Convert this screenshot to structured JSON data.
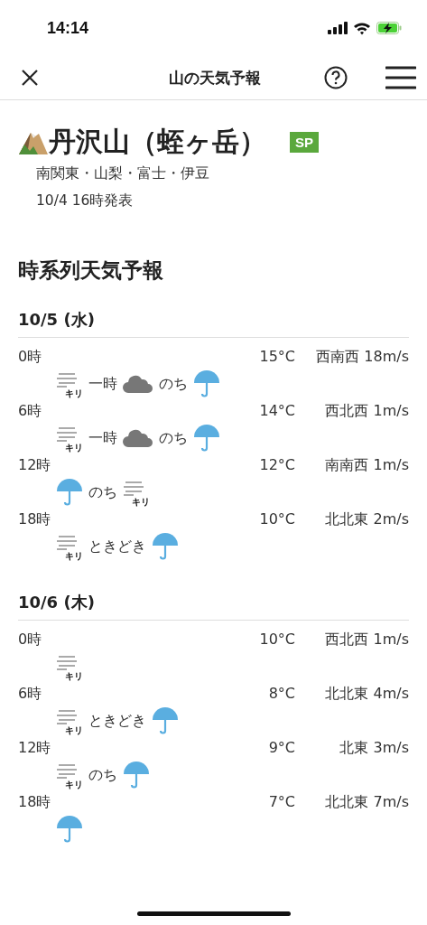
{
  "status_bar": {
    "time": "14:14"
  },
  "header": {
    "title": "山の天気予報"
  },
  "mountain": {
    "name": "丹沢山（蛭ヶ岳）",
    "badge": "SP",
    "region": "南関東・山梨・富士・伊豆",
    "issued": "10/4 16時発表"
  },
  "section_title": "時系列天気予報",
  "days": [
    {
      "date": "10/5 (水)",
      "rows": [
        {
          "hour": "0時",
          "temp": "15°C",
          "wind": "西南西 18m/s",
          "weather": [
            {
              "kind": "fog",
              "label": "キリ"
            },
            {
              "kind": "word",
              "text": "一時"
            },
            {
              "kind": "cloud"
            },
            {
              "kind": "word",
              "text": "のち"
            },
            {
              "kind": "rain"
            }
          ]
        },
        {
          "hour": "6時",
          "temp": "14°C",
          "wind": "西北西 1m/s",
          "weather": [
            {
              "kind": "fog",
              "label": "キリ"
            },
            {
              "kind": "word",
              "text": "一時"
            },
            {
              "kind": "cloud"
            },
            {
              "kind": "word",
              "text": "のち"
            },
            {
              "kind": "rain"
            }
          ]
        },
        {
          "hour": "12時",
          "temp": "12°C",
          "wind": "南南西 1m/s",
          "weather": [
            {
              "kind": "rain"
            },
            {
              "kind": "word",
              "text": "のち"
            },
            {
              "kind": "fog",
              "label": "キリ"
            }
          ]
        },
        {
          "hour": "18時",
          "temp": "10°C",
          "wind": "北北東 2m/s",
          "weather": [
            {
              "kind": "fog",
              "label": "キリ"
            },
            {
              "kind": "word",
              "text": "ときどき"
            },
            {
              "kind": "rain"
            }
          ]
        }
      ]
    },
    {
      "date": "10/6 (木)",
      "rows": [
        {
          "hour": "0時",
          "temp": "10°C",
          "wind": "西北西 1m/s",
          "weather": [
            {
              "kind": "fog",
              "label": "キリ"
            }
          ]
        },
        {
          "hour": "6時",
          "temp": "8°C",
          "wind": "北北東 4m/s",
          "weather": [
            {
              "kind": "fog",
              "label": "キリ"
            },
            {
              "kind": "word",
              "text": "ときどき"
            },
            {
              "kind": "rain"
            }
          ]
        },
        {
          "hour": "12時",
          "temp": "9°C",
          "wind": "北東 3m/s",
          "weather": [
            {
              "kind": "fog",
              "label": "キリ"
            },
            {
              "kind": "word",
              "text": "のち"
            },
            {
              "kind": "rain"
            }
          ]
        },
        {
          "hour": "18時",
          "temp": "7°C",
          "wind": "北北東 7m/s",
          "weather": [
            {
              "kind": "rain"
            }
          ]
        }
      ]
    }
  ]
}
